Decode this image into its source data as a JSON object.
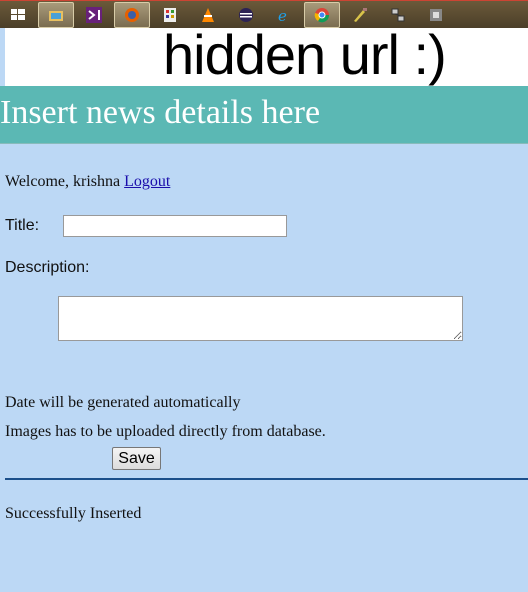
{
  "taskbar": {
    "icons": [
      "windows-start-icon",
      "file-explorer-icon",
      "visual-studio-icon",
      "firefox-icon",
      "calculator-icon",
      "vlc-icon",
      "eclipse-icon",
      "internet-explorer-icon",
      "chrome-icon",
      "paint-brush-icon",
      "network-tool-icon",
      "unknown-app-icon"
    ]
  },
  "urlbar": {
    "text": "hidden url :)"
  },
  "header": {
    "title": "Insert news details here"
  },
  "welcome": {
    "text": "Welcome, krishna",
    "logout": "Logout"
  },
  "form": {
    "title_label": "Title:",
    "title_value": "",
    "description_label": "Description:",
    "description_value": "",
    "date_note": "Date will be generated automatically",
    "images_note": "Images has to be uploaded directly from database.",
    "save_label": "Save"
  },
  "status": {
    "message": "Successfully Inserted"
  },
  "colors": {
    "background": "#bcd8f5",
    "header": "#5bb8b4",
    "divider": "#1b4f8a"
  }
}
